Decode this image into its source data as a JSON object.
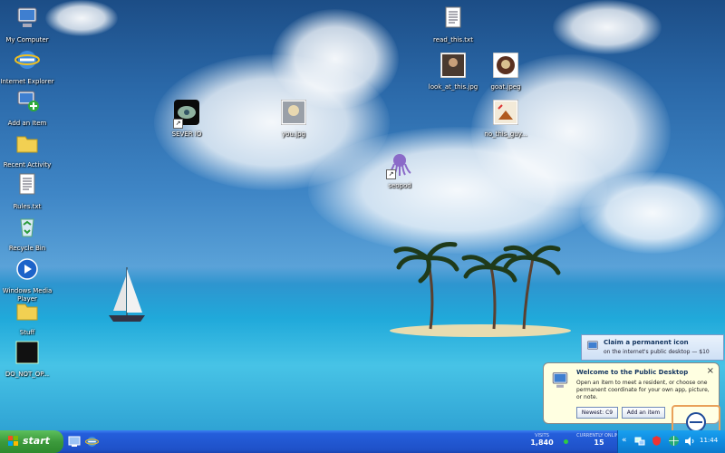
{
  "desktop_icons_left": [
    {
      "label": "My Computer",
      "icon": "computer-icon"
    },
    {
      "label": "Internet Explorer",
      "icon": "internet-explorer-icon"
    },
    {
      "label": "Add an Item",
      "icon": "add-item-icon"
    },
    {
      "label": "Recent Activity",
      "icon": "folder-icon"
    },
    {
      "label": "Rules.txt",
      "icon": "text-file-icon"
    },
    {
      "label": "Recycle Bin",
      "icon": "recycle-bin-icon"
    },
    {
      "label": "Windows Media Player",
      "icon": "media-player-icon"
    },
    {
      "label": "Stuff",
      "icon": "folder-icon"
    },
    {
      "label": "DO_NOT_OP...",
      "icon": "black-file-icon"
    }
  ],
  "desktop_icons_free": [
    {
      "label": "SEVER IO",
      "icon": "game-icon"
    },
    {
      "label": "you.jpg",
      "icon": "image-icon"
    },
    {
      "label": "read_this.txt",
      "icon": "text-file-icon"
    },
    {
      "label": "look_at_this.jpg",
      "icon": "image-icon"
    },
    {
      "label": "goat.jpeg",
      "icon": "image-icon"
    },
    {
      "label": "no_this_guy...",
      "icon": "image-icon"
    },
    {
      "label": "seopod",
      "icon": "octopus-icon"
    }
  ],
  "claim_popup": {
    "title": "Claim a permanent icon",
    "subtitle": "on the internet's public desktop — $10"
  },
  "welcome_balloon": {
    "title": "Welcome to the Public Desktop",
    "body": "Open an item to meet a resident, or choose one permanent coordinate for your own app, picture, or note.",
    "newest_button": "Newest: C9",
    "add_button": "Add an item",
    "close": "×"
  },
  "taskbar": {
    "start_label": "start",
    "visits_label": "VISITS",
    "visits_value": "1,840",
    "online_label": "CURRENTLY ONLINE",
    "online_value": "15",
    "clock": "11:44"
  },
  "colors": {
    "taskbar_blue": "#245edb",
    "start_green": "#3c9a3c",
    "tray_blue": "#0f8be0",
    "balloon_bg": "#ffffe1",
    "online_dot": "#2ecc40"
  }
}
